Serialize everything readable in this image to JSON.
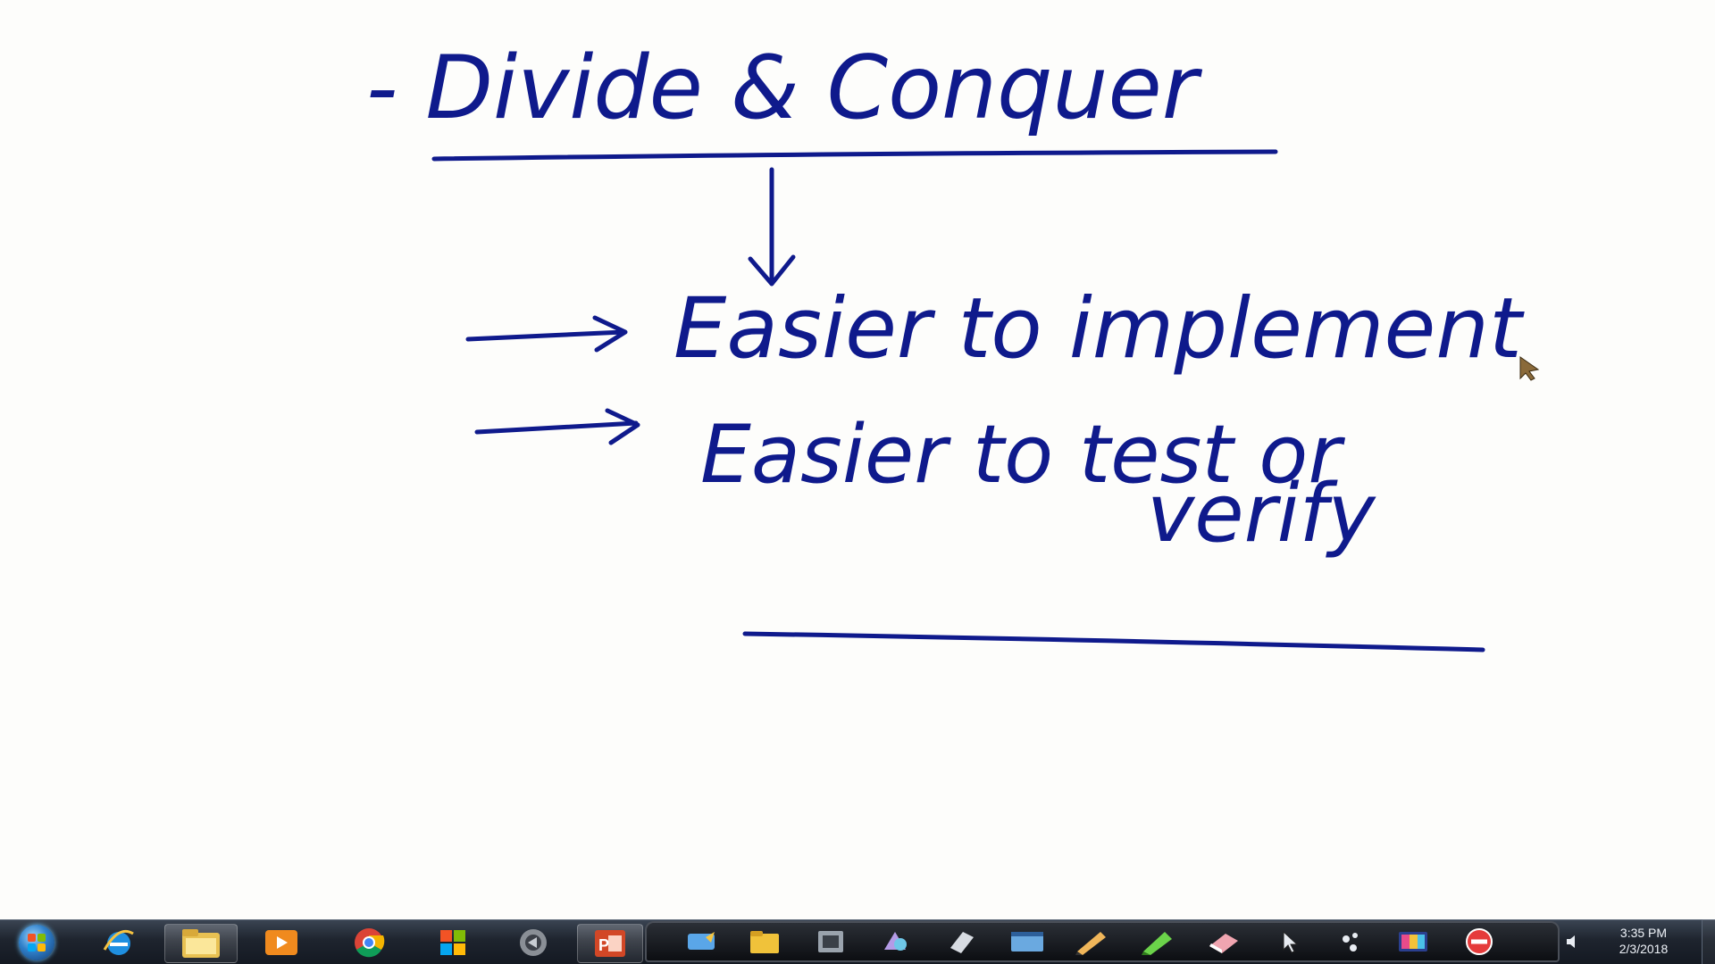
{
  "whiteboard": {
    "heading": "- Divide & Conquer",
    "points": [
      "Easier to implement",
      "Easier to test or",
      "verify"
    ]
  },
  "ink_color": "#0f1a8c",
  "taskbar": {
    "start_icon": "windows-start-orb-icon",
    "pinned": [
      {
        "icon": "internet-explorer-icon"
      },
      {
        "icon": "file-explorer-icon"
      },
      {
        "icon": "media-player-icon"
      },
      {
        "icon": "chrome-icon"
      },
      {
        "icon": "windows-flag-app-icon"
      },
      {
        "icon": "grey-disc-app-icon"
      },
      {
        "icon": "powerpoint-icon"
      }
    ],
    "ink_tools": [
      {
        "icon": "arrow-tool-icon"
      },
      {
        "icon": "folder-icon"
      },
      {
        "icon": "film-icon"
      },
      {
        "icon": "shapes-icon"
      },
      {
        "icon": "page-icon"
      },
      {
        "icon": "screen-icon"
      },
      {
        "icon": "pencil-icon"
      },
      {
        "icon": "highlighter-icon"
      },
      {
        "icon": "eraser-icon"
      },
      {
        "icon": "cursor-icon"
      },
      {
        "icon": "dots-icon"
      },
      {
        "icon": "color-palette-icon"
      },
      {
        "icon": "no-entry-icon"
      }
    ],
    "clock": {
      "time": "3:35 PM",
      "date": "2/3/2018"
    }
  }
}
